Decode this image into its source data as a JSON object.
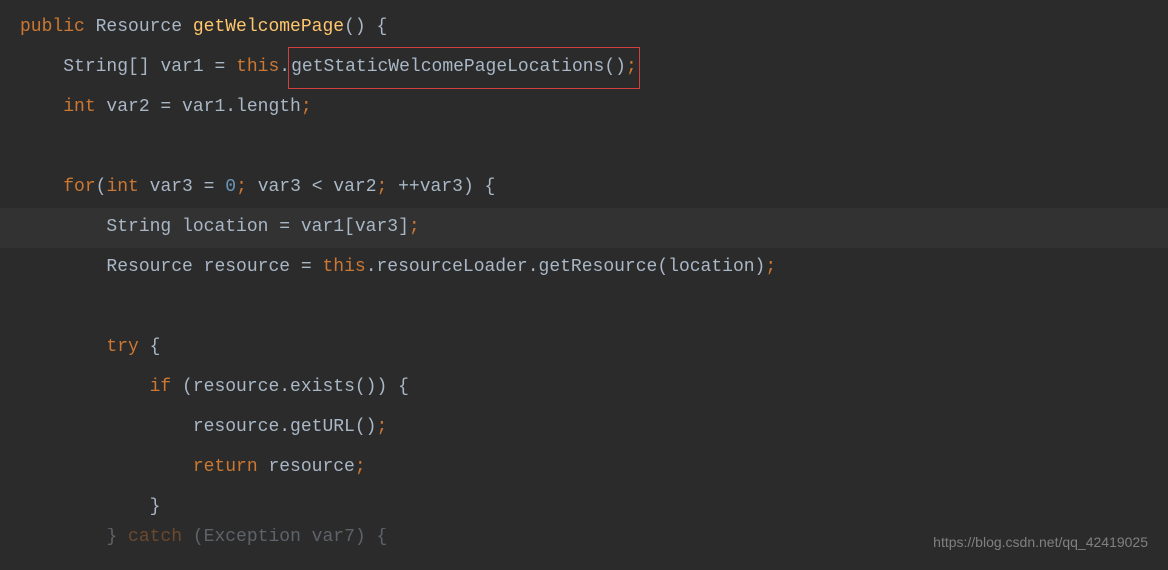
{
  "code": {
    "line1": {
      "kw_public": "public",
      "type_resource": " Resource ",
      "method": "getWelcomePage",
      "parens": "() {"
    },
    "line2": {
      "indent": "    ",
      "type_string": "String[] ",
      "var1": "var1 = ",
      "kw_this": "this",
      "dot": ".",
      "method_call": "getStaticWelcomePageLocations()",
      "semi": ";"
    },
    "line3": {
      "indent": "    ",
      "kw_int": "int",
      "rest": " var2 = var1.length",
      "semi": ";"
    },
    "line4": {
      "blank": " "
    },
    "line5": {
      "indent": "    ",
      "kw_for": "for",
      "open": "(",
      "kw_int": "int",
      "assign": " var3 = ",
      "zero": "0",
      "semi1": ";",
      "cond": " var3 < var2",
      "semi2": ";",
      "inc": " ++var3) {"
    },
    "line6": {
      "indent": "        ",
      "type": "String location = var1[var3]",
      "semi": ";"
    },
    "line7": {
      "indent": "        ",
      "type": "Resource resource = ",
      "kw_this": "this",
      "rest": ".resourceLoader.getResource(location)",
      "semi": ";"
    },
    "line8": {
      "blank": " "
    },
    "line9": {
      "indent": "        ",
      "kw_try": "try",
      "brace": " {"
    },
    "line10": {
      "indent": "            ",
      "kw_if": "if",
      "cond": " (resource.exists()) {"
    },
    "line11": {
      "indent": "                ",
      "call": "resource.getURL()",
      "semi": ";"
    },
    "line12": {
      "indent": "                ",
      "kw_return": "return",
      "rest": " resource",
      "semi": ";"
    },
    "line13": {
      "indent": "            ",
      "brace": "}"
    },
    "line14": {
      "indent": "        ",
      "brace": "} ",
      "kw_catch": "catch",
      "rest": " (Exception var7) {"
    }
  },
  "watermark": "https://blog.csdn.net/qq_42419025"
}
